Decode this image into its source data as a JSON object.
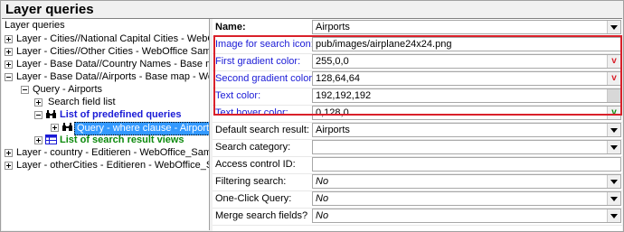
{
  "window": {
    "title": "Layer queries"
  },
  "tree": {
    "header": "Layer queries",
    "items": [
      {
        "label": "Layer - Cities//National Capital Cities - WebOffice"
      },
      {
        "label": "Layer - Cities//Other Cities - WebOffice Sample P"
      },
      {
        "label": "Layer - Base Data//Country Names - Base map -"
      },
      {
        "label": "Layer - Base Data//Airports - Base map - WebOffi"
      },
      {
        "label": "Query - Airports"
      },
      {
        "label": "Search field list"
      },
      {
        "label": "List of predefined queries"
      },
      {
        "label": "Query - where clause - Airports"
      },
      {
        "label": "List of search result views"
      },
      {
        "label": "Layer - country - Editieren - WebOffice_SampleP"
      },
      {
        "label": "Layer - otherCities - Editieren - WebOffice_Sampl"
      }
    ]
  },
  "properties": {
    "rows": [
      {
        "label": "Name:",
        "value": "Airports",
        "control": "dropdown"
      },
      {
        "label": "Image for search icon:",
        "value": "pub/images/airplane24x24.png",
        "control": "text"
      },
      {
        "label": "First gradient color:",
        "value": "255,0,0",
        "control": "color",
        "button": "v",
        "button_color": "#d9202a"
      },
      {
        "label": "Second gradient color:",
        "value": "128,64,64",
        "control": "color",
        "button": "v",
        "button_color": "#d9202a"
      },
      {
        "label": "Text color:",
        "value": "192,192,192",
        "control": "color",
        "button": "",
        "button_color": "#c0c0c0"
      },
      {
        "label": "Text hover color:",
        "value": "0,128,0",
        "control": "color",
        "button": "v",
        "button_color": "#0d8a0d"
      },
      {
        "label": "Default search result:",
        "value": "Airports",
        "control": "dropdown"
      },
      {
        "label": "Search category:",
        "value": "",
        "control": "dropdown"
      },
      {
        "label": "Access control ID:",
        "value": "",
        "control": "text"
      },
      {
        "label": "Filtering search:",
        "value": "No",
        "control": "dropdown"
      },
      {
        "label": "One-Click Query:",
        "value": "No",
        "control": "dropdown"
      },
      {
        "label": "Merge search fields?",
        "value": "No",
        "control": "dropdown"
      }
    ]
  },
  "colors": {
    "highlight_border": "#d9202a",
    "selection": "#3399ff",
    "link_blue": "#1a1ad6",
    "link_green": "#0d8a0d"
  }
}
